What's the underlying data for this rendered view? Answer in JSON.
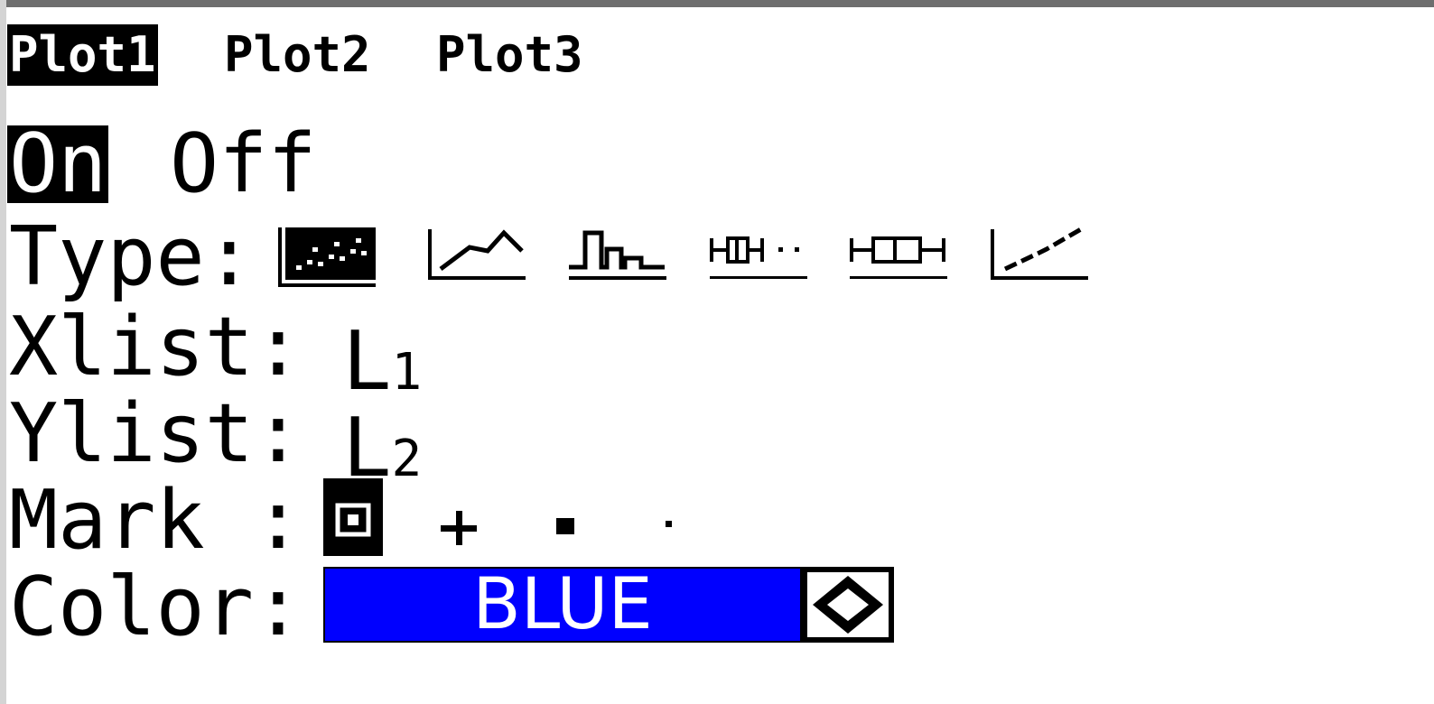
{
  "plots": [
    {
      "label": "Plot1",
      "selected": true
    },
    {
      "label": "Plot2",
      "selected": false
    },
    {
      "label": "Plot3",
      "selected": false
    }
  ],
  "onoff": {
    "on_label": "On",
    "off_label": "Off",
    "selected": "On"
  },
  "type": {
    "label": "Type:",
    "options": [
      "scatter-plot-icon",
      "xyline-plot-icon",
      "histogram-plot-icon",
      "modified-boxplot-icon",
      "boxplot-icon",
      "normal-probability-plot-icon"
    ],
    "selected_index": 0
  },
  "xlist": {
    "label": "Xlist:",
    "value": "L",
    "sub": "1"
  },
  "ylist": {
    "label": "Ylist:",
    "value": "L",
    "sub": "2"
  },
  "mark": {
    "label": "Mark :",
    "options": [
      "box-mark-icon",
      "plus-mark-icon",
      "square-mark-icon",
      "dot-mark-icon"
    ],
    "selected_index": 0
  },
  "color": {
    "label": "Color:",
    "value": "BLUE",
    "swatch": "#0000ff",
    "arrow_icon": "left-right-arrow-icon"
  }
}
